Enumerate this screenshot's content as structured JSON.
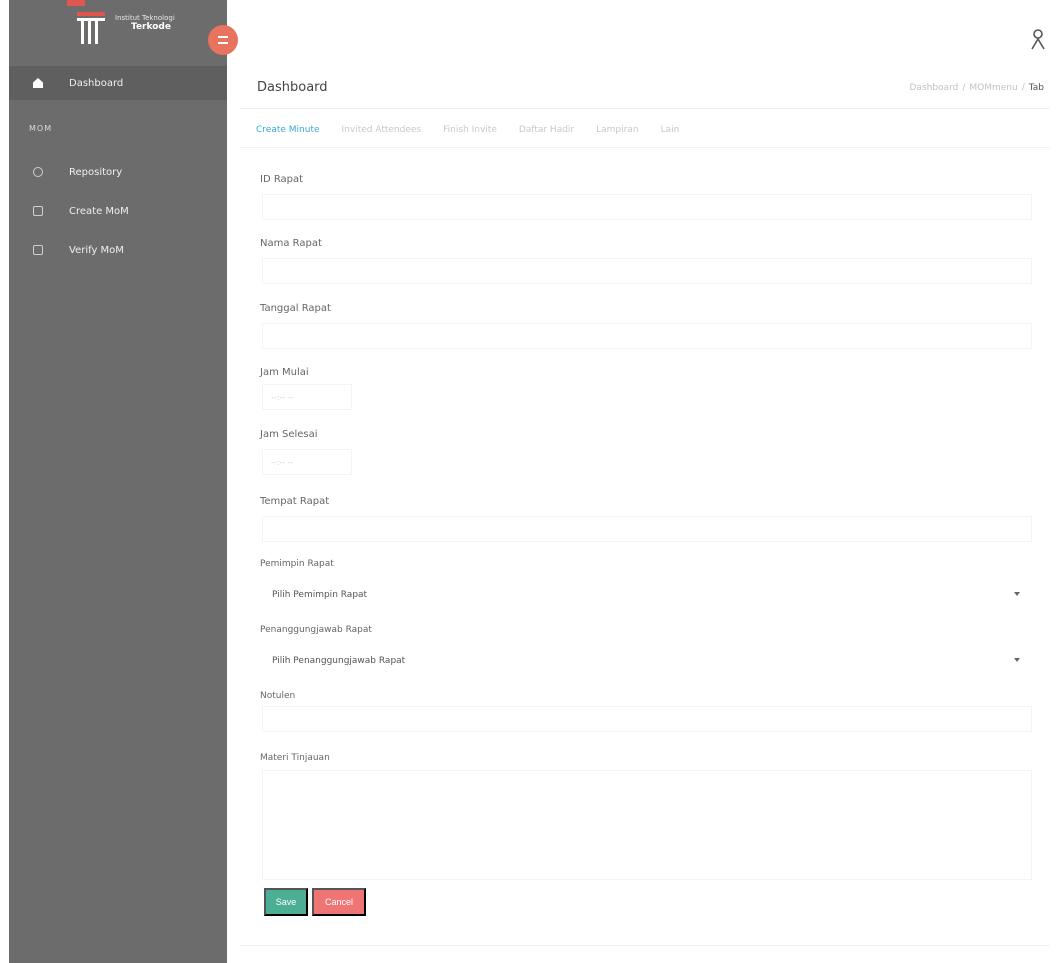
{
  "sidebar": {
    "logo": {
      "line1": "Institut Teknologi",
      "line2": "Terkode"
    },
    "items": [
      {
        "label": "Dashboard",
        "icon": "home-icon"
      },
      {
        "label": "Repository",
        "icon": "circle-icon"
      },
      {
        "label": "Create MoM",
        "icon": "edit-icon"
      },
      {
        "label": "Verify MoM",
        "icon": "check-icon"
      }
    ],
    "section_header": "MOM"
  },
  "header": {
    "title": "Dashboard",
    "breadcrumb": [
      "Dashboard",
      "MOMmenu",
      "Tab"
    ]
  },
  "tabs": [
    {
      "label": "Create Minute",
      "active": true
    },
    {
      "label": "Invited Attendees"
    },
    {
      "label": "Finish Invite"
    },
    {
      "label": "Daftar Hadir"
    },
    {
      "label": "Lampiran"
    },
    {
      "label": "Lain"
    }
  ],
  "form": {
    "id_rapat": {
      "label": "ID Rapat",
      "value": ""
    },
    "nama_rapat": {
      "label": "Nama Rapat",
      "value": ""
    },
    "tanggal_rapat": {
      "label": "Tanggal Rapat",
      "value": ""
    },
    "jam_mulai": {
      "label": "Jam Mulai",
      "value": "--:-- --"
    },
    "jam_selesai": {
      "label": "Jam Selesai",
      "value": "--:-- --"
    },
    "tempat_rapat": {
      "label": "Tempat Rapat",
      "value": ""
    },
    "pemimpin_rapat": {
      "label": "Pemimpin Rapat",
      "selected": "Pilih Pemimpin Rapat"
    },
    "penanggungjawab": {
      "label": "Penanggungjawab Rapat",
      "selected": "Pilih Penanggungjawab Rapat"
    },
    "notulen": {
      "label": "Notulen",
      "value": ""
    },
    "materi": {
      "label": "Materi Tinjauan",
      "value": ""
    }
  },
  "buttons": {
    "save": "Save",
    "cancel": "Cancel"
  },
  "colors": {
    "sidebar_bg": "#6c6c6c",
    "accent_orange": "#e8735e",
    "save_green": "#4cae94",
    "cancel_red": "#ef7474",
    "active_tab": "#3aa8d8"
  }
}
